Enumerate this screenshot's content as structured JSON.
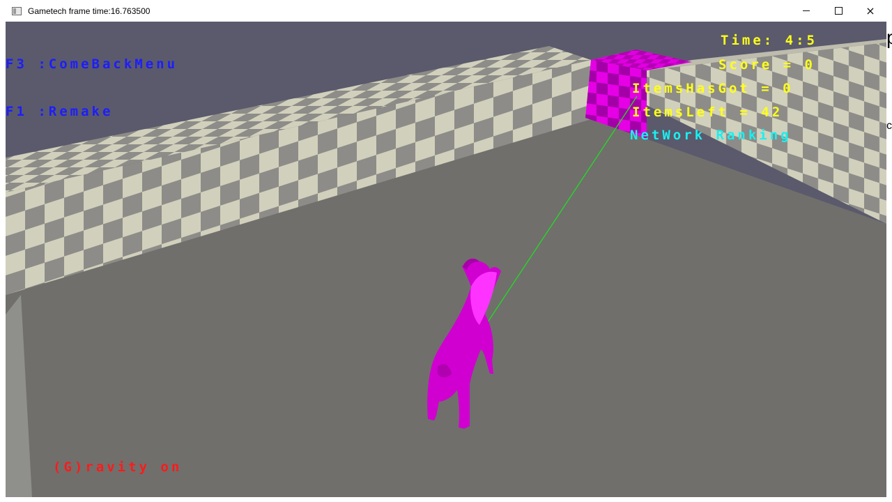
{
  "window": {
    "title": "Gametech frame time:16.763500",
    "icon": "app-window-icon",
    "controls": {
      "minimize": "minimize-icon",
      "maximize": "maximize-icon",
      "close": "×"
    }
  },
  "hud": {
    "menu_hint": "F3 :ComeBackMenu",
    "remake_hint": "F1 :Remake",
    "time": "Time: 4:5",
    "score": "Score = 0",
    "items_got": "ItemsHasGot = 0",
    "items_left": "ItemsLeft = 42",
    "network_ranking": "NetWork Ranking",
    "gravity": "(G)ravity on"
  },
  "desktop_edge": {
    "glyph_top": "p",
    "glyph_mid": "c"
  },
  "colors": {
    "sky": "#5a5a6c",
    "floor": "#706f6c",
    "checker_light": "#d1d0bc",
    "checker_dark": "#8d8c88",
    "goat": "#d400d4",
    "pillar": "#cc00cc",
    "laser": "#22dd22",
    "hud_blue": "#1d1dff",
    "hud_yellow": "#ffff1a",
    "hud_cyan": "#19f0f0",
    "hud_red": "#ff1a1a"
  }
}
